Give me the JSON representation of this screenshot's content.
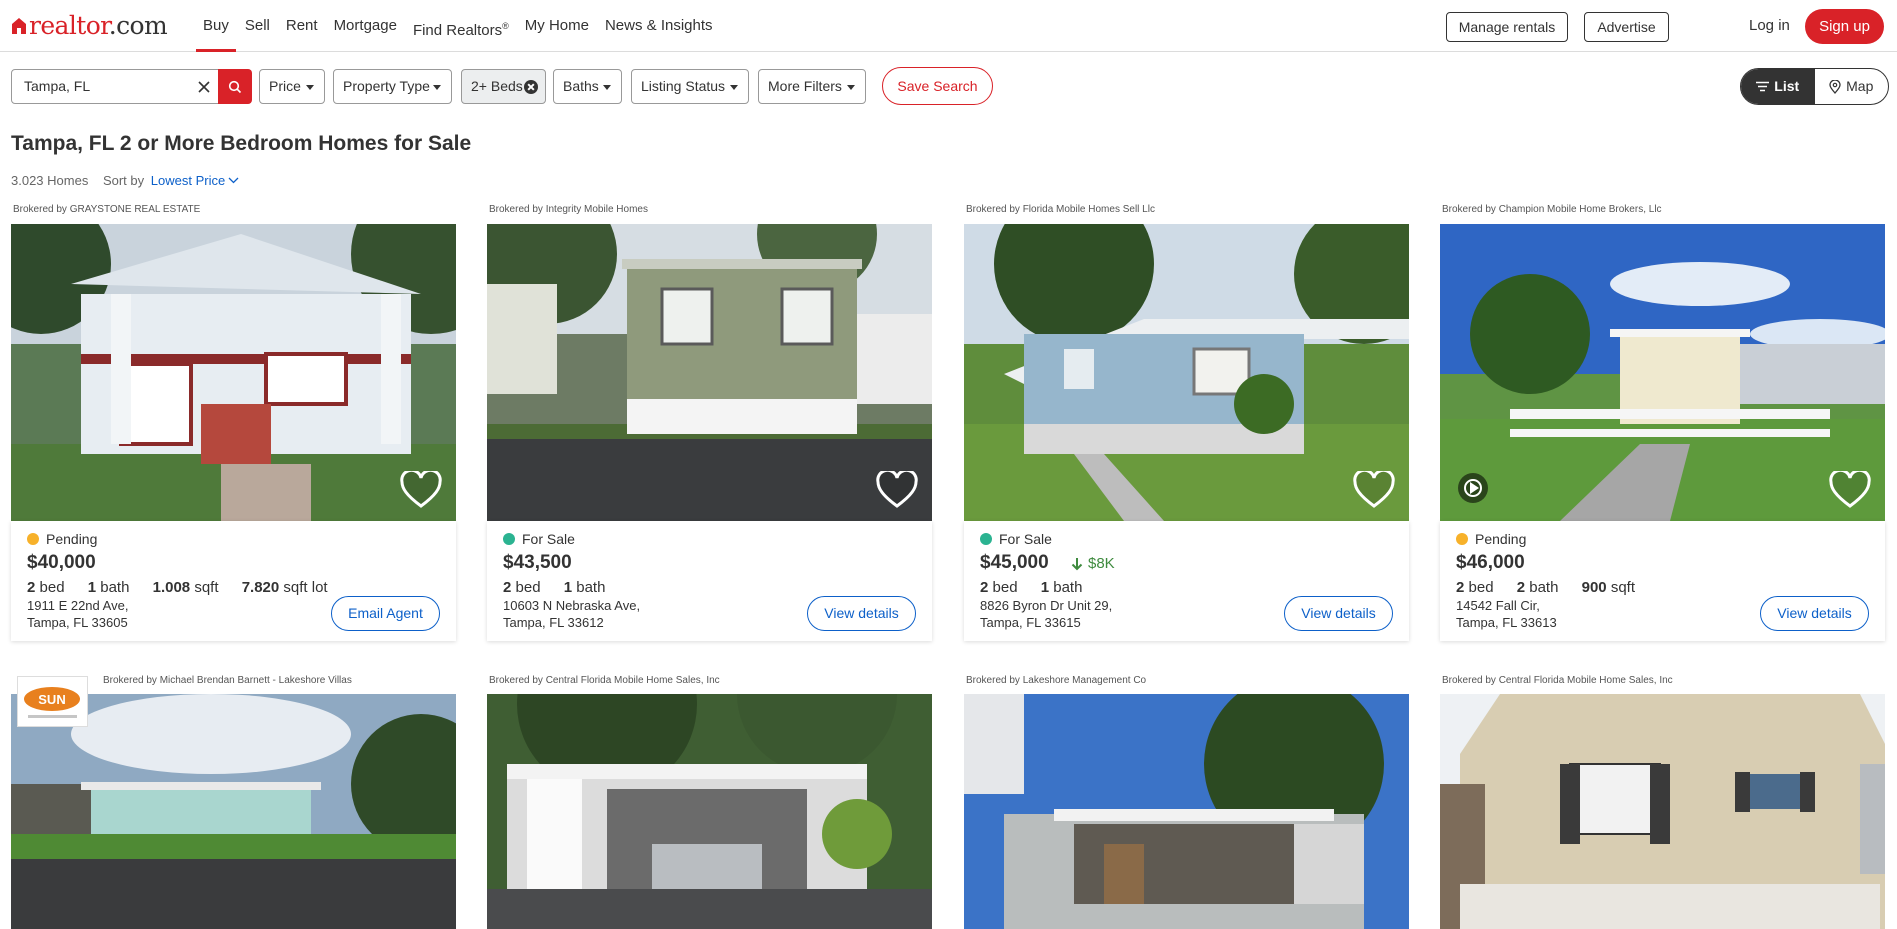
{
  "header": {
    "logo_main": "realtor",
    "logo_suffix": ".com",
    "nav": [
      {
        "label": "Buy",
        "active": true
      },
      {
        "label": "Sell"
      },
      {
        "label": "Rent"
      },
      {
        "label": "Mortgage"
      },
      {
        "label": "Find Realtors",
        "sup": "®"
      },
      {
        "label": "My Home"
      },
      {
        "label": "News & Insights"
      }
    ],
    "manage_rentals": "Manage rentals",
    "advertise": "Advertise",
    "login": "Log in",
    "signup": "Sign up"
  },
  "filters": {
    "search_value": "Tampa, FL",
    "price": "Price",
    "property_type": "Property Type",
    "beds": "2+ Beds",
    "baths": "Baths",
    "listing_status": "Listing Status",
    "more_filters": "More Filters",
    "save_search": "Save Search",
    "view_list": "List",
    "view_map": "Map"
  },
  "results": {
    "title": "Tampa, FL 2 or More Bedroom Homes for Sale",
    "count": "3.023 Homes",
    "sort_label": "Sort by",
    "sort_value": "Lowest Price"
  },
  "colors": {
    "brand_red": "#d92228",
    "link_blue": "#0d60c9",
    "pending": "#f7b12a",
    "for_sale": "#2bb391",
    "price_drop": "#3f8b3f"
  },
  "listings": [
    {
      "broker": "Brokered by GRAYSTONE REAL ESTATE",
      "status": "Pending",
      "status_color": "#f7b12a",
      "price": "$40,000",
      "beds": "2",
      "beds_unit": "bed",
      "baths": "1",
      "baths_unit": "bath",
      "sqft": "1.008",
      "sqft_unit": "sqft",
      "lot": "7.820",
      "lot_unit": "sqft lot",
      "address1": "1911 E 22nd Ave,",
      "address2": "Tampa, FL 33605",
      "action": "Email Agent"
    },
    {
      "broker": "Brokered by Integrity Mobile Homes",
      "status": "For Sale",
      "status_color": "#2bb391",
      "price": "$43,500",
      "beds": "2",
      "beds_unit": "bed",
      "baths": "1",
      "baths_unit": "bath",
      "address1": "10603 N Nebraska Ave,",
      "address2": "Tampa, FL 33612",
      "action": "View details"
    },
    {
      "broker": "Brokered by Florida Mobile Homes Sell Llc",
      "status": "For Sale",
      "status_color": "#2bb391",
      "price": "$45,000",
      "price_drop": "$8K",
      "beds": "2",
      "beds_unit": "bed",
      "baths": "1",
      "baths_unit": "bath",
      "address1": "8826 Byron Dr Unit 29,",
      "address2": "Tampa, FL 33615",
      "action": "View details"
    },
    {
      "broker": "Brokered by Champion Mobile Home Brokers, Llc",
      "status": "Pending",
      "status_color": "#f7b12a",
      "price": "$46,000",
      "beds": "2",
      "beds_unit": "bed",
      "baths": "2",
      "baths_unit": "bath",
      "sqft": "900",
      "sqft_unit": "sqft",
      "address1": "14542 Fall Cir,",
      "address2": "Tampa, FL 33613",
      "action": "View details"
    },
    {
      "broker": "Brokered by Michael Brendan Barnett - Lakeshore Villas",
      "logo_text": "SUN"
    },
    {
      "broker": "Brokered by Central Florida Mobile Home Sales, Inc"
    },
    {
      "broker": "Brokered by Lakeshore Management Co"
    },
    {
      "broker": "Brokered by Central Florida Mobile Home Sales, Inc"
    }
  ]
}
